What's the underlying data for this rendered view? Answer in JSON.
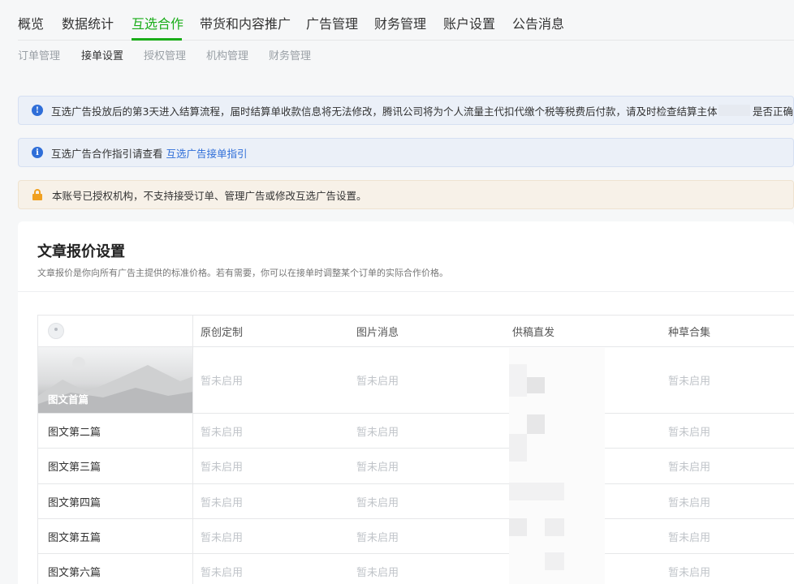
{
  "topnav": {
    "items": [
      "概览",
      "数据统计",
      "互选合作",
      "带货和内容推广",
      "广告管理",
      "财务管理",
      "账户设置",
      "公告消息"
    ],
    "active_index": 2
  },
  "subnav": {
    "items": [
      "订单管理",
      "接单设置",
      "授权管理",
      "机构管理",
      "财务管理"
    ],
    "active_index": 1
  },
  "notices": {
    "settlement": {
      "text": "互选广告投放后的第3天进入结算流程，届时结算单收款信息将无法修改，腾讯公司将为个人流量主代扣代缴个税等税费后付款，请及时检查结算主体",
      "tail": "是否正确"
    },
    "guide": {
      "text": "互选广告合作指引请查看",
      "link": "互选广告接单指引"
    },
    "authorized": {
      "text": "本账号已授权机构，不支持接受订单、管理广告或修改互选广告设置。"
    }
  },
  "pricing": {
    "title": "文章报价设置",
    "description": "文章报价是你向所有广告主提供的标准价格。若有需要，你可以在接单时调整某个订单的实际合作价格。",
    "columns": [
      "原创定制",
      "图片消息",
      "供稿直发",
      "种草合集"
    ],
    "rows": [
      {
        "label": "图文首篇",
        "values": [
          "暂未启用",
          "暂未启用",
          "",
          "暂未启用"
        ]
      },
      {
        "label": "图文第二篇",
        "values": [
          "暂未启用",
          "暂未启用",
          "",
          "暂未启用"
        ]
      },
      {
        "label": "图文第三篇",
        "values": [
          "暂未启用",
          "暂未启用",
          "",
          "暂未启用"
        ]
      },
      {
        "label": "图文第四篇",
        "values": [
          "暂未启用",
          "暂未启用",
          "",
          "暂未启用"
        ]
      },
      {
        "label": "图文第五篇",
        "values": [
          "暂未启用",
          "暂未启用",
          "",
          "暂未启用"
        ]
      },
      {
        "label": "图文第六篇",
        "values": [
          "暂未启用",
          "暂未启用",
          "",
          "暂未启用"
        ]
      }
    ]
  },
  "colors": {
    "accent": "#1aad19",
    "link": "#2f6ed8",
    "warning": "#f0a020"
  }
}
